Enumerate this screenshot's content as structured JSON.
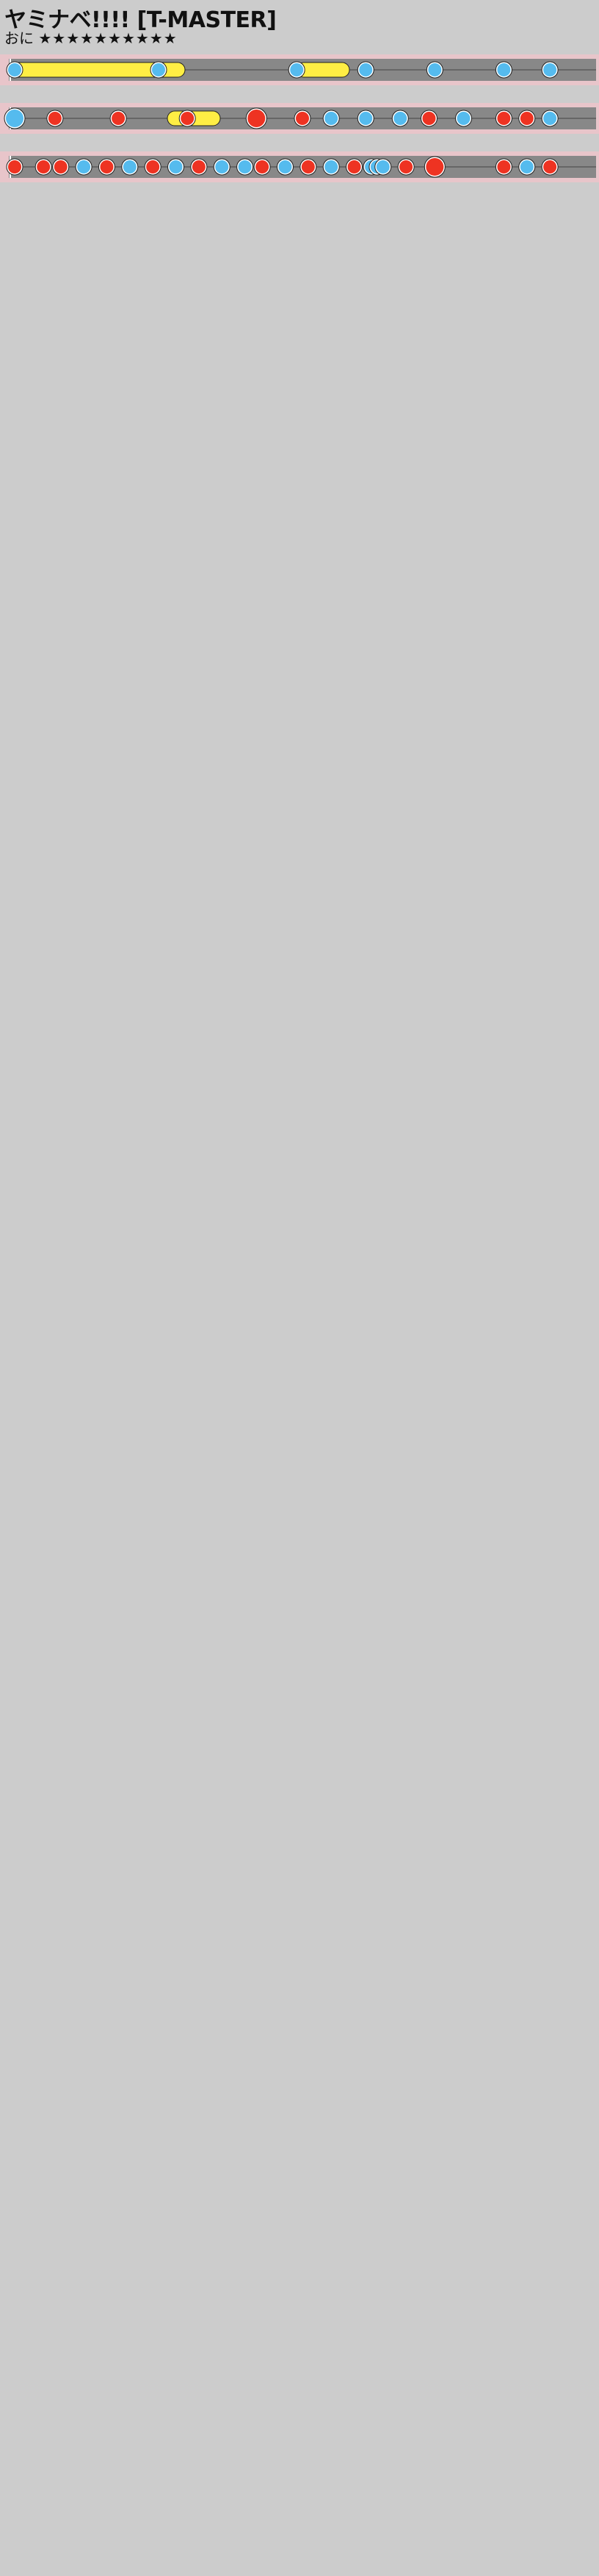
{
  "header": {
    "title": "ヤミナベ!!!! [T-MASTER]",
    "difficulty": "おに",
    "stars": "★★★★★★★★★★"
  },
  "colors": {
    "background": "#cccccc",
    "lane": "#888888",
    "lane_line": "#444444",
    "gogo": "#ffc0c8",
    "don": "#ee3322",
    "ka": "#55bbee",
    "roll": "#ffee44"
  },
  "chart_data": {
    "type": "taiko-chart",
    "rows": [
      [
        [
          0.0,
          "k"
        ],
        [
          0.25,
          "k"
        ],
        [
          0.49,
          "k"
        ],
        [
          0.61,
          "k"
        ],
        [
          0.73,
          "k"
        ],
        [
          0.85,
          "k"
        ],
        [
          0.93,
          "k"
        ]
      ],
      [
        [
          0.0,
          "K"
        ],
        [
          0.07,
          "d"
        ],
        [
          0.18,
          "d"
        ],
        [
          0.3,
          "d"
        ],
        [
          0.42,
          "D"
        ],
        [
          0.5,
          "d"
        ],
        [
          0.55,
          "k"
        ],
        [
          0.61,
          "k"
        ],
        [
          0.67,
          "k"
        ],
        [
          0.72,
          "d"
        ],
        [
          0.78,
          "k"
        ],
        [
          0.85,
          "d"
        ],
        [
          0.89,
          "d"
        ],
        [
          0.93,
          "k"
        ]
      ],
      [
        [
          0.0,
          "d"
        ],
        [
          0.05,
          "d"
        ],
        [
          0.08,
          "d"
        ],
        [
          0.12,
          "k"
        ],
        [
          0.16,
          "d"
        ],
        [
          0.2,
          "k"
        ],
        [
          0.24,
          "d"
        ],
        [
          0.28,
          "k"
        ],
        [
          0.32,
          "d"
        ],
        [
          0.36,
          "k"
        ],
        [
          0.4,
          "k"
        ],
        [
          0.43,
          "d"
        ],
        [
          0.47,
          "k"
        ],
        [
          0.51,
          "d"
        ],
        [
          0.55,
          "k"
        ],
        [
          0.59,
          "d"
        ],
        [
          0.62,
          "k"
        ],
        [
          0.63,
          "k"
        ],
        [
          0.64,
          "k"
        ],
        [
          0.68,
          "d"
        ],
        [
          0.73,
          "D"
        ],
        [
          0.85,
          "d"
        ],
        [
          0.89,
          "k"
        ],
        [
          0.93,
          "d"
        ]
      ]
    ],
    "roll_rows": [
      [
        [
          0.0,
          0.3
        ],
        [
          0.49,
          0.58
        ]
      ],
      [
        [
          0.27,
          0.36
        ]
      ]
    ]
  }
}
